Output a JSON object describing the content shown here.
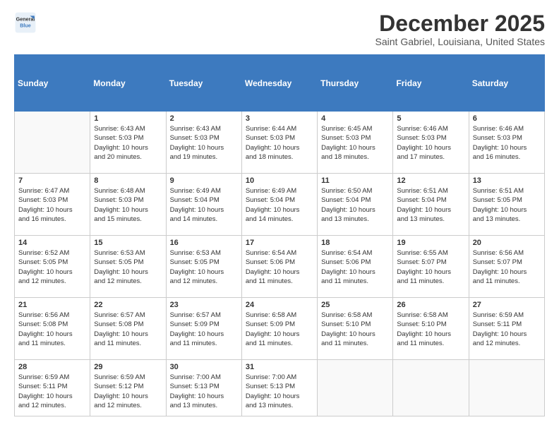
{
  "logo": {
    "line1": "General",
    "line2": "Blue"
  },
  "title": "December 2025",
  "location": "Saint Gabriel, Louisiana, United States",
  "weekdays": [
    "Sunday",
    "Monday",
    "Tuesday",
    "Wednesday",
    "Thursday",
    "Friday",
    "Saturday"
  ],
  "weeks": [
    [
      {
        "day": "",
        "info": ""
      },
      {
        "day": "1",
        "info": "Sunrise: 6:43 AM\nSunset: 5:03 PM\nDaylight: 10 hours\nand 20 minutes."
      },
      {
        "day": "2",
        "info": "Sunrise: 6:43 AM\nSunset: 5:03 PM\nDaylight: 10 hours\nand 19 minutes."
      },
      {
        "day": "3",
        "info": "Sunrise: 6:44 AM\nSunset: 5:03 PM\nDaylight: 10 hours\nand 18 minutes."
      },
      {
        "day": "4",
        "info": "Sunrise: 6:45 AM\nSunset: 5:03 PM\nDaylight: 10 hours\nand 18 minutes."
      },
      {
        "day": "5",
        "info": "Sunrise: 6:46 AM\nSunset: 5:03 PM\nDaylight: 10 hours\nand 17 minutes."
      },
      {
        "day": "6",
        "info": "Sunrise: 6:46 AM\nSunset: 5:03 PM\nDaylight: 10 hours\nand 16 minutes."
      }
    ],
    [
      {
        "day": "7",
        "info": "Sunrise: 6:47 AM\nSunset: 5:03 PM\nDaylight: 10 hours\nand 16 minutes."
      },
      {
        "day": "8",
        "info": "Sunrise: 6:48 AM\nSunset: 5:03 PM\nDaylight: 10 hours\nand 15 minutes."
      },
      {
        "day": "9",
        "info": "Sunrise: 6:49 AM\nSunset: 5:04 PM\nDaylight: 10 hours\nand 14 minutes."
      },
      {
        "day": "10",
        "info": "Sunrise: 6:49 AM\nSunset: 5:04 PM\nDaylight: 10 hours\nand 14 minutes."
      },
      {
        "day": "11",
        "info": "Sunrise: 6:50 AM\nSunset: 5:04 PM\nDaylight: 10 hours\nand 13 minutes."
      },
      {
        "day": "12",
        "info": "Sunrise: 6:51 AM\nSunset: 5:04 PM\nDaylight: 10 hours\nand 13 minutes."
      },
      {
        "day": "13",
        "info": "Sunrise: 6:51 AM\nSunset: 5:05 PM\nDaylight: 10 hours\nand 13 minutes."
      }
    ],
    [
      {
        "day": "14",
        "info": "Sunrise: 6:52 AM\nSunset: 5:05 PM\nDaylight: 10 hours\nand 12 minutes."
      },
      {
        "day": "15",
        "info": "Sunrise: 6:53 AM\nSunset: 5:05 PM\nDaylight: 10 hours\nand 12 minutes."
      },
      {
        "day": "16",
        "info": "Sunrise: 6:53 AM\nSunset: 5:05 PM\nDaylight: 10 hours\nand 12 minutes."
      },
      {
        "day": "17",
        "info": "Sunrise: 6:54 AM\nSunset: 5:06 PM\nDaylight: 10 hours\nand 11 minutes."
      },
      {
        "day": "18",
        "info": "Sunrise: 6:54 AM\nSunset: 5:06 PM\nDaylight: 10 hours\nand 11 minutes."
      },
      {
        "day": "19",
        "info": "Sunrise: 6:55 AM\nSunset: 5:07 PM\nDaylight: 10 hours\nand 11 minutes."
      },
      {
        "day": "20",
        "info": "Sunrise: 6:56 AM\nSunset: 5:07 PM\nDaylight: 10 hours\nand 11 minutes."
      }
    ],
    [
      {
        "day": "21",
        "info": "Sunrise: 6:56 AM\nSunset: 5:08 PM\nDaylight: 10 hours\nand 11 minutes."
      },
      {
        "day": "22",
        "info": "Sunrise: 6:57 AM\nSunset: 5:08 PM\nDaylight: 10 hours\nand 11 minutes."
      },
      {
        "day": "23",
        "info": "Sunrise: 6:57 AM\nSunset: 5:09 PM\nDaylight: 10 hours\nand 11 minutes."
      },
      {
        "day": "24",
        "info": "Sunrise: 6:58 AM\nSunset: 5:09 PM\nDaylight: 10 hours\nand 11 minutes."
      },
      {
        "day": "25",
        "info": "Sunrise: 6:58 AM\nSunset: 5:10 PM\nDaylight: 10 hours\nand 11 minutes."
      },
      {
        "day": "26",
        "info": "Sunrise: 6:58 AM\nSunset: 5:10 PM\nDaylight: 10 hours\nand 11 minutes."
      },
      {
        "day": "27",
        "info": "Sunrise: 6:59 AM\nSunset: 5:11 PM\nDaylight: 10 hours\nand 12 minutes."
      }
    ],
    [
      {
        "day": "28",
        "info": "Sunrise: 6:59 AM\nSunset: 5:11 PM\nDaylight: 10 hours\nand 12 minutes."
      },
      {
        "day": "29",
        "info": "Sunrise: 6:59 AM\nSunset: 5:12 PM\nDaylight: 10 hours\nand 12 minutes."
      },
      {
        "day": "30",
        "info": "Sunrise: 7:00 AM\nSunset: 5:13 PM\nDaylight: 10 hours\nand 13 minutes."
      },
      {
        "day": "31",
        "info": "Sunrise: 7:00 AM\nSunset: 5:13 PM\nDaylight: 10 hours\nand 13 minutes."
      },
      {
        "day": "",
        "info": ""
      },
      {
        "day": "",
        "info": ""
      },
      {
        "day": "",
        "info": ""
      }
    ]
  ]
}
